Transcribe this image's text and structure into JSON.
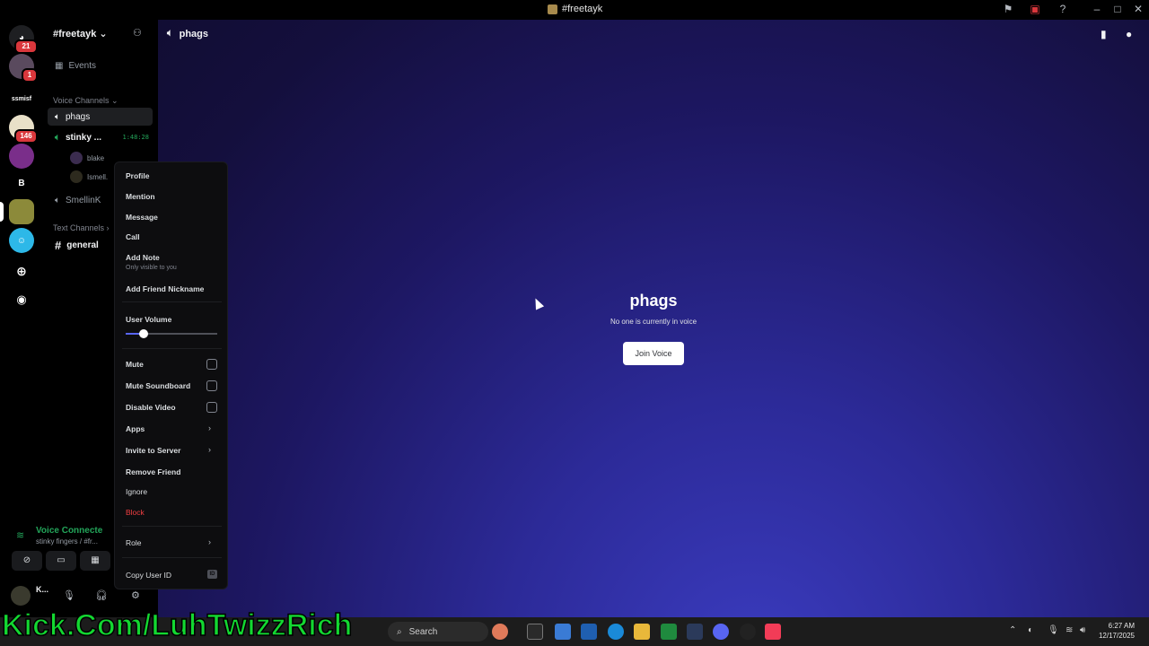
{
  "window": {
    "title": "#freetayk"
  },
  "rail": {
    "badges": [
      "21",
      "1",
      "146"
    ],
    "server_initial_text": "ssmisf",
    "server_letter": "B"
  },
  "sidebar": {
    "guild_name": "#freetayk",
    "events_label": "Events",
    "voice_category": "Voice Channels",
    "voice_channels": [
      {
        "name": "phags"
      },
      {
        "name": "stinky ...",
        "timer": "1:48:28"
      },
      {
        "name": "SmellinK"
      }
    ],
    "voice_users": [
      {
        "name": "blake"
      },
      {
        "name": "Ismell."
      }
    ],
    "text_category": "Text Channels",
    "text_channels": [
      {
        "name": "general"
      }
    ]
  },
  "voice_panel": {
    "status": "Voice Connecte",
    "location": "stinky fingers / #fr...",
    "user_name": "K..."
  },
  "main": {
    "channel_name": "phags",
    "voice_title": "phags",
    "empty_text": "No one is currently in voice",
    "join_label": "Join Voice"
  },
  "context_menu": {
    "profile": "Profile",
    "mention": "Mention",
    "message": "Message",
    "call": "Call",
    "add_note": "Add Note",
    "add_note_sub": "Only visible to you",
    "add_friend_nickname": "Add Friend Nickname",
    "user_volume": "User Volume",
    "user_volume_level": 0.2,
    "mute": "Mute",
    "mute_soundboard": "Mute Soundboard",
    "disable_video": "Disable Video",
    "apps": "Apps",
    "invite_to_server": "Invite to Server",
    "remove_friend": "Remove Friend",
    "ignore": "Ignore",
    "block": "Block",
    "role": "Role",
    "copy_user_id": "Copy User ID",
    "id_badge": "ID"
  },
  "overlay": {
    "text": "Kick.Com/LuhTwizzRich"
  },
  "taskbar": {
    "search_label": "Search",
    "time": "6:27 AM",
    "date": "12/17/2025"
  },
  "colors": {
    "accent": "#5865f2",
    "voice_green": "#23a55a",
    "danger": "#f23f42",
    "kick_green": "#13d831"
  }
}
